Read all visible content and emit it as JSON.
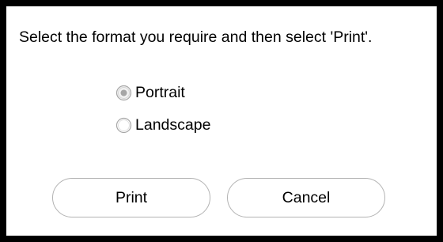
{
  "dialog": {
    "message": "Select the format you require and then select 'Print'.",
    "options": [
      {
        "label": "Portrait",
        "selected": true
      },
      {
        "label": "Landscape",
        "selected": false
      }
    ],
    "buttons": {
      "print_label": "Print",
      "cancel_label": "Cancel"
    }
  },
  "colors": {
    "background": "#000000",
    "dialog": "#ffffff",
    "button_border": "#b3b3b3",
    "radio_border": "#a6a6a6"
  }
}
